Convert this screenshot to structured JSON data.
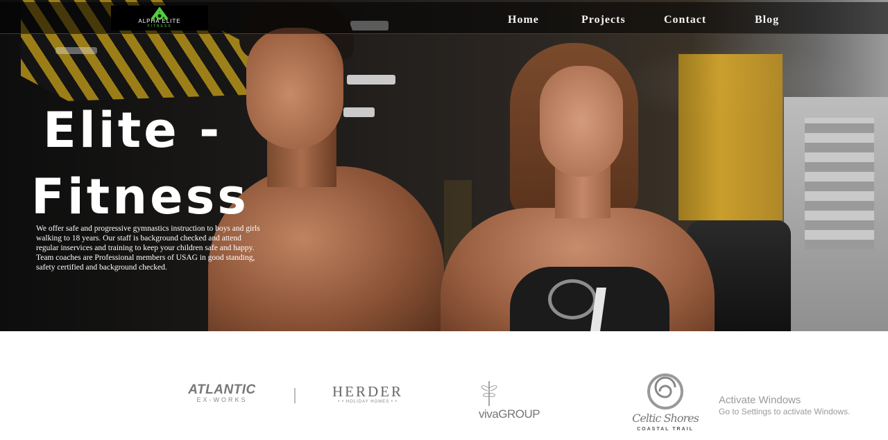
{
  "nav": {
    "logo_text": "ALPHA ELITE",
    "logo_subtext": "FITNESS",
    "items": [
      {
        "label": "Home"
      },
      {
        "label": "Projects"
      },
      {
        "label": "Contact"
      },
      {
        "label": "Blog"
      }
    ],
    "accent_border_color": "#8c1c1c",
    "logo_accent_color": "#4fd13a"
  },
  "hero": {
    "title_line1": "Elite -",
    "title_line2": "Fitness",
    "description": "We offer safe and progressive gymnastics instruction to boys and girls walking to 18 years. Our staff is background checked and attend regular inservices and training to keep your children safe and happy. Team coaches are Professional members of USAG in good standing, safety certified and background checked."
  },
  "partners": [
    {
      "name": "ATLANTIC",
      "tagline": "EX-WORKS"
    },
    {
      "name": "HERDER",
      "tagline": "• • HOLIDAY HOMES • •"
    },
    {
      "name": "vivaGROUP",
      "tagline": ""
    },
    {
      "name": "Celtic Shores",
      "tagline": "COASTAL TRAIL"
    }
  ],
  "watermark": {
    "title": "Activate Windows",
    "subtitle": "Go to Settings to activate Windows."
  }
}
